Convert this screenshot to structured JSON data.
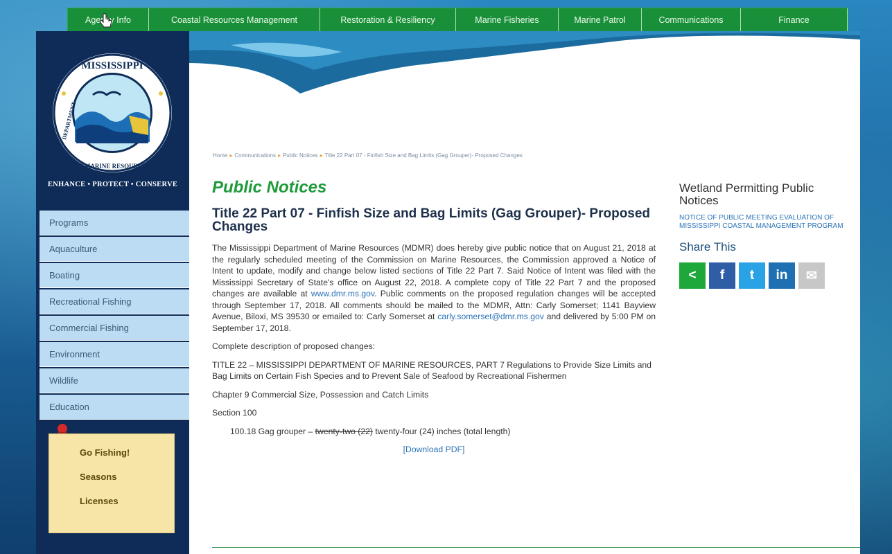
{
  "nav": {
    "tabs": [
      {
        "label": "Agency Info",
        "width": 117
      },
      {
        "label": "Coastal Resources Management",
        "width": 247
      },
      {
        "label": "Restoration & Resiliency",
        "width": 196
      },
      {
        "label": "Marine Fisheries",
        "width": 148
      },
      {
        "label": "Marine Patrol",
        "width": 120
      },
      {
        "label": "Communications",
        "width": 143
      },
      {
        "label": "Finance",
        "width": 154
      }
    ]
  },
  "sidebar": {
    "logo_text_top": "MISSISSIPPI",
    "logo_text_left": "DEPARTMENT",
    "logo_text_right": "OF MARINE RESOURCES",
    "tagline": "ENHANCE • PROTECT • CONSERVE",
    "menu": [
      "Programs",
      "Aquaculture",
      "Boating",
      "Recreational Fishing",
      "Commercial Fishing",
      "Environment",
      "Wildlife",
      "Education"
    ],
    "note_links": [
      "Go Fishing!",
      "Seasons",
      "Licenses"
    ]
  },
  "breadcrumb": [
    "Home",
    "Communications",
    "Public Notices",
    "Title 22 Part 07 - Finfish Size and Bag Limits (Gag Grouper)- Proposed Changes"
  ],
  "main": {
    "heading": "Public Notices",
    "subtitle": "Title 22 Part 07 - Finfish Size and Bag Limits (Gag Grouper)- Proposed Changes",
    "para1_a": "The Mississippi Department of Marine Resources (MDMR) does hereby give public notice that on August 21, 2018 at the regularly scheduled meeting of the Commission on Marine Resources, the Commission approved a Notice of Intent to update, modify and change below listed sections of Title 22 Part 7. Said Notice of Intent was filed with the Mississippi Secretary of State's office on August 22, 2018. A complete copy of Title 22 Part 7 and the proposed changes are available at ",
    "para1_link1": "www.dmr.ms.gov",
    "para1_b": ". Public comments on the proposed regulation changes will be accepted through September 17, 2018. All comments should be mailed to the MDMR, Attn: Carly Somerset; 1141 Bayview Avenue, Biloxi, MS 39530 or emailed to: Carly Somerset at ",
    "para1_link2": "carly.somerset@dmr.ms.gov",
    "para1_c": " and delivered by 5:00 PM on September 17, 2018.",
    "para2": "Complete description of proposed changes:",
    "para3": "TITLE 22 – MISSISSIPPI DEPARTMENT OF MARINE RESOURCES, PART 7 Regulations to Provide Size Limits and Bag Limits on Certain Fish Species and to Prevent Sale of Seafood by Recreational Fishermen",
    "para4": "Chapter 9 Commercial Size, Possession and Catch Limits",
    "para5": "Section 100",
    "rule_a": "100.18 Gag grouper – ",
    "rule_strike": "twenty-two (22)",
    "rule_b": " twenty-four (24) inches (total length)",
    "download": "[Download PDF]"
  },
  "right": {
    "heading": "Wetland Permitting Public Notices",
    "link": "NOTICE OF PUBLIC MEETING EVALUATION OF MISSISSIPPI COASTAL MANAGEMENT PROGRAM",
    "share_heading": "Share This",
    "share_buttons": [
      {
        "name": "share",
        "glyph": "<",
        "color": "#1fa83a"
      },
      {
        "name": "facebook",
        "glyph": "f",
        "color": "#2f5ea7"
      },
      {
        "name": "twitter",
        "glyph": "t",
        "color": "#2aa3e6"
      },
      {
        "name": "linkedin",
        "glyph": "in",
        "color": "#1f6fb3"
      },
      {
        "name": "email",
        "glyph": "✉",
        "color": "#c7c7c7"
      }
    ]
  }
}
